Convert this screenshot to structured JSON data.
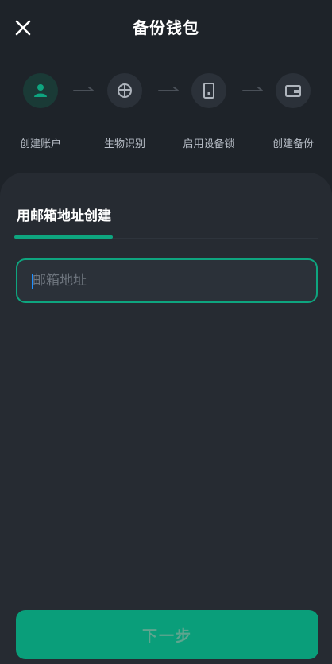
{
  "header": {
    "title": "备份钱包",
    "close_icon": "close-icon"
  },
  "steps": [
    {
      "label": "创建账户",
      "icon": "user-icon",
      "state": "active"
    },
    {
      "label": "生物识别",
      "icon": "biometric-icon",
      "state": "pending"
    },
    {
      "label": "启用设备锁",
      "icon": "device-lock-icon",
      "state": "pending"
    },
    {
      "label": "创建备份",
      "icon": "wallet-icon",
      "state": "pending"
    }
  ],
  "tab": {
    "label": "用邮箱地址创建"
  },
  "email_input": {
    "placeholder": "邮箱地址",
    "value": ""
  },
  "next_button": {
    "label": "下一步"
  },
  "colors": {
    "background": "#1e2329",
    "panel": "#262b32",
    "accent": "#0ea57f",
    "button": "#0a9e7a"
  }
}
